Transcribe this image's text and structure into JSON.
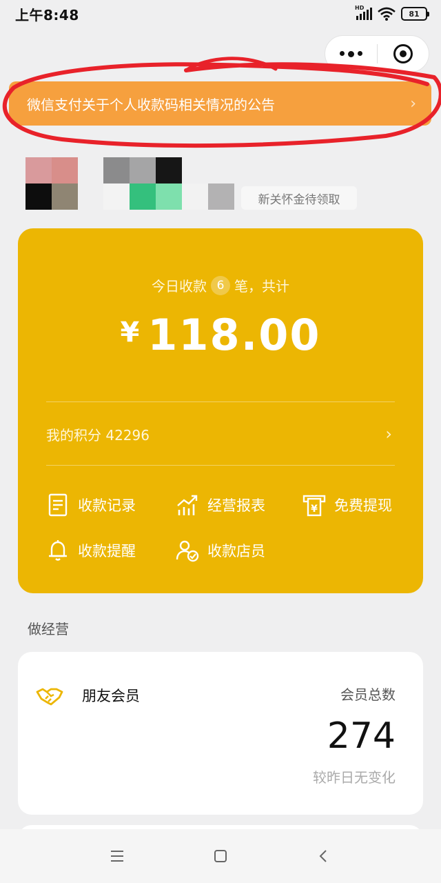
{
  "status_bar": {
    "time": "上午8:48",
    "network": "HD",
    "battery": "81",
    "icons": [
      "signal-icon",
      "wifi-icon",
      "battery-icon"
    ]
  },
  "capsule": {
    "more_icon": "more-dots-icon",
    "close_icon": "target-icon"
  },
  "notice": {
    "text": "微信支付关于个人收款码相关情况的公告",
    "chevron": "›"
  },
  "promo": {
    "text": "新关怀金待领取"
  },
  "summary": {
    "today_prefix": "今日收款",
    "today_count": "6",
    "today_suffix": "笔，共计",
    "currency": "¥",
    "amount": "118.00",
    "points_label": "我的积分 42296",
    "points_chevron": "›"
  },
  "actions": [
    {
      "label": "收款记录",
      "icon": "document-icon"
    },
    {
      "label": "经营报表",
      "icon": "chart-trend-icon"
    },
    {
      "label": "免费提现",
      "icon": "cash-out-icon"
    },
    {
      "label": "收款提醒",
      "icon": "bell-icon"
    },
    {
      "label": "收款店员",
      "icon": "staff-icon"
    }
  ],
  "section": {
    "title": "做经营"
  },
  "member_card": {
    "title": "朋友会员",
    "icon": "handshake-icon",
    "total_label": "会员总数",
    "total": "274",
    "change": "较昨日无变化"
  },
  "navbar": {
    "icons": [
      "menu-icon",
      "home-icon",
      "back-icon"
    ]
  },
  "colors": {
    "card_yellow": "#ecb603",
    "notice_orange": "#f6a03e",
    "annotation_red": "#e8222a"
  }
}
